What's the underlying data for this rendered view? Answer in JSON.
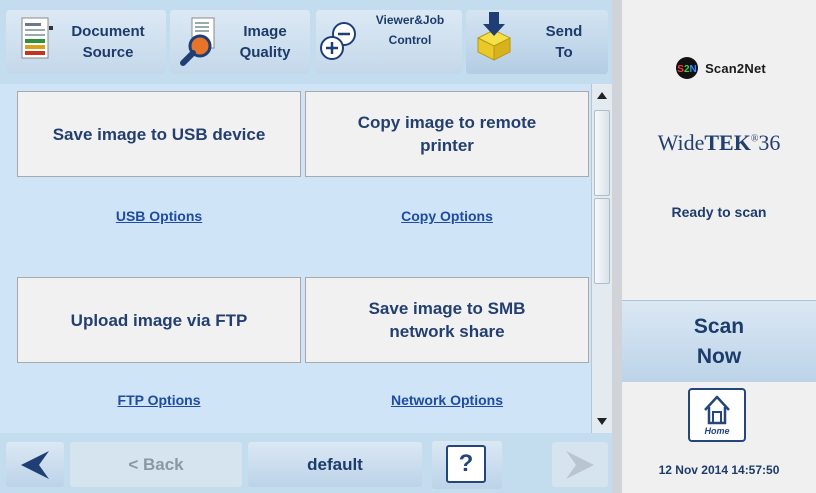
{
  "toolbar": {
    "items": [
      {
        "label_line1": "Document",
        "label_line2": "Source",
        "icon": "document-icon"
      },
      {
        "label_line1": "Image",
        "label_line2": "Quality",
        "icon": "magnifier-icon"
      },
      {
        "label_line1": "Viewer&Job",
        "label_line2": "Control",
        "icon": "zoom-icon"
      },
      {
        "label_line1": "Send",
        "label_line2": "To",
        "icon": "box-arrow-icon"
      }
    ]
  },
  "main": {
    "actions": [
      {
        "label": "Save image to USB device",
        "option": "USB Options"
      },
      {
        "label": "Copy image to remote printer",
        "option": "Copy Options"
      },
      {
        "label": "Upload image via FTP",
        "option": "FTP Options"
      },
      {
        "label": "Save image to SMB network share",
        "option": "Network Options"
      }
    ]
  },
  "bottom": {
    "back_label": "< Back",
    "default_label": "default",
    "help_label": "?"
  },
  "right": {
    "brand_name": "Scan2Net",
    "brand_badge": "S2N",
    "product_prefix": "Wide",
    "product_main": "TEK",
    "product_suffix": "36",
    "status": "Ready to scan",
    "scan_line1": "Scan",
    "scan_line2": "Now",
    "home_label": "Home",
    "datetime": "12 Nov 2014 14:57:50"
  },
  "colors": {
    "accent_navy": "#1d3b6b",
    "panel_blue": "#cfe4f6",
    "toolbar_blue": "#c3dcee",
    "link_blue": "#1f4ba0"
  }
}
